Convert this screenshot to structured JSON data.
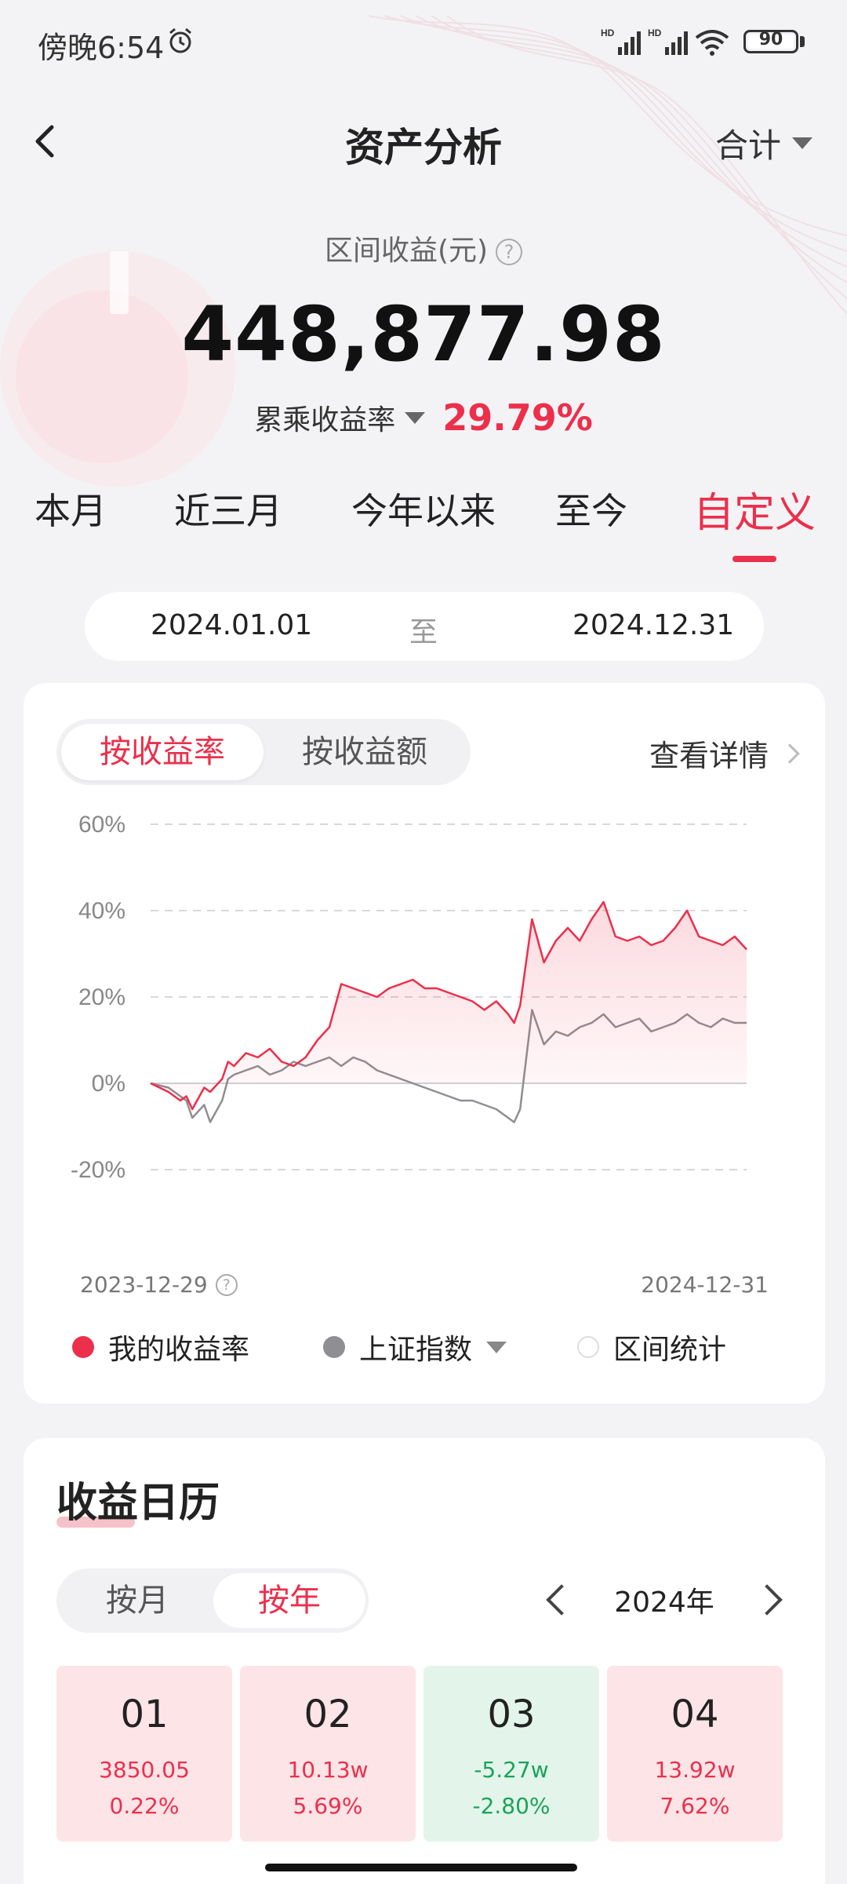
{
  "status_bar": {
    "time": "傍晚6:54",
    "battery": "90",
    "signal_labels": [
      "HD",
      "HD"
    ]
  },
  "header": {
    "title": "资产分析",
    "back_icon": "chevron-left-icon",
    "dropdown_label": "合计"
  },
  "summary": {
    "label": "区间收益(元)",
    "amount": "448,877.98",
    "rate_label": "累乘收益率",
    "rate_value": "29.79%"
  },
  "period_tabs": [
    {
      "label": "本月",
      "active": false
    },
    {
      "label": "近三月",
      "active": false
    },
    {
      "label": "今年以来",
      "active": false
    },
    {
      "label": "至今",
      "active": false
    },
    {
      "label": "自定义",
      "active": true
    }
  ],
  "date_range": {
    "start": "2024.01.01",
    "separator": "至",
    "end": "2024.12.31"
  },
  "chart_card": {
    "segment": [
      {
        "label": "按收益率",
        "active": true
      },
      {
        "label": "按收益额",
        "active": false
      }
    ],
    "detail_link": "查看详情",
    "axis_start_date": "2023-12-29",
    "axis_end_date": "2024-12-31",
    "legend": [
      {
        "label": "我的收益率",
        "color": "#ec2f4b",
        "style": "filled"
      },
      {
        "label": "上证指数",
        "color": "#8e8e93",
        "style": "filled",
        "has_dropdown": true
      },
      {
        "label": "区间统计",
        "color": "#ffffff",
        "style": "outline"
      }
    ]
  },
  "chart_data": {
    "type": "line",
    "xlabel": "",
    "ylabel": "",
    "ylim": [
      -20,
      60
    ],
    "yticks": [
      "60%",
      "40%",
      "20%",
      "0%",
      "-20%"
    ],
    "ytick_values": [
      60,
      40,
      20,
      0,
      -20
    ],
    "x_range": [
      "2023-12-29",
      "2024-12-31"
    ],
    "grid": true,
    "series": [
      {
        "name": "我的收益率",
        "color": "#ec2f4b",
        "fill": true,
        "x": [
          0,
          3,
          5,
          6,
          7,
          9,
          10,
          12,
          13,
          14,
          16,
          18,
          20,
          22,
          24,
          26,
          28,
          30,
          32,
          34,
          36,
          38,
          40,
          42,
          44,
          46,
          48,
          50,
          52,
          54,
          56,
          58,
          60,
          61,
          62,
          64,
          66,
          68,
          70,
          72,
          74,
          76,
          78,
          80,
          82,
          84,
          86,
          88,
          90,
          92,
          94,
          96,
          98,
          100
        ],
        "values": [
          0,
          -2,
          -4,
          -3,
          -6,
          -1,
          -2,
          1,
          5,
          4,
          7,
          6,
          8,
          5,
          4,
          6,
          10,
          13,
          23,
          22,
          21,
          20,
          22,
          23,
          24,
          22,
          22,
          21,
          20,
          19,
          17,
          19,
          16,
          14,
          18,
          38,
          28,
          33,
          36,
          33,
          38,
          42,
          34,
          33,
          34,
          32,
          33,
          36,
          40,
          34,
          33,
          32,
          34,
          31
        ]
      },
      {
        "name": "上证指数",
        "color": "#8e8e93",
        "fill": false,
        "x": [
          0,
          3,
          5,
          6,
          7,
          9,
          10,
          12,
          13,
          14,
          16,
          18,
          20,
          22,
          24,
          26,
          28,
          30,
          32,
          34,
          36,
          38,
          40,
          42,
          44,
          46,
          48,
          50,
          52,
          54,
          56,
          58,
          60,
          61,
          62,
          64,
          66,
          68,
          70,
          72,
          74,
          76,
          78,
          80,
          82,
          84,
          86,
          88,
          90,
          92,
          94,
          96,
          98,
          100
        ],
        "values": [
          0,
          -1,
          -3,
          -4,
          -8,
          -5,
          -9,
          -4,
          1,
          2,
          3,
          4,
          2,
          3,
          5,
          4,
          5,
          6,
          4,
          6,
          5,
          3,
          2,
          1,
          0,
          -1,
          -2,
          -3,
          -4,
          -4,
          -5,
          -6,
          -8,
          -9,
          -6,
          17,
          9,
          12,
          11,
          13,
          14,
          16,
          13,
          14,
          15,
          12,
          13,
          14,
          16,
          14,
          13,
          15,
          14,
          14
        ]
      }
    ]
  },
  "calendar": {
    "title": "收益日历",
    "segment": [
      {
        "label": "按月",
        "active": false
      },
      {
        "label": "按年",
        "active": true
      }
    ],
    "year": "2024年",
    "months": [
      {
        "month": "01",
        "amount": "3850.05",
        "rate": "0.22%",
        "trend": "up"
      },
      {
        "month": "02",
        "amount": "10.13w",
        "rate": "5.69%",
        "trend": "up"
      },
      {
        "month": "03",
        "amount": "-5.27w",
        "rate": "-2.80%",
        "trend": "down"
      },
      {
        "month": "04",
        "amount": "13.92w",
        "rate": "7.62%",
        "trend": "up"
      }
    ]
  }
}
